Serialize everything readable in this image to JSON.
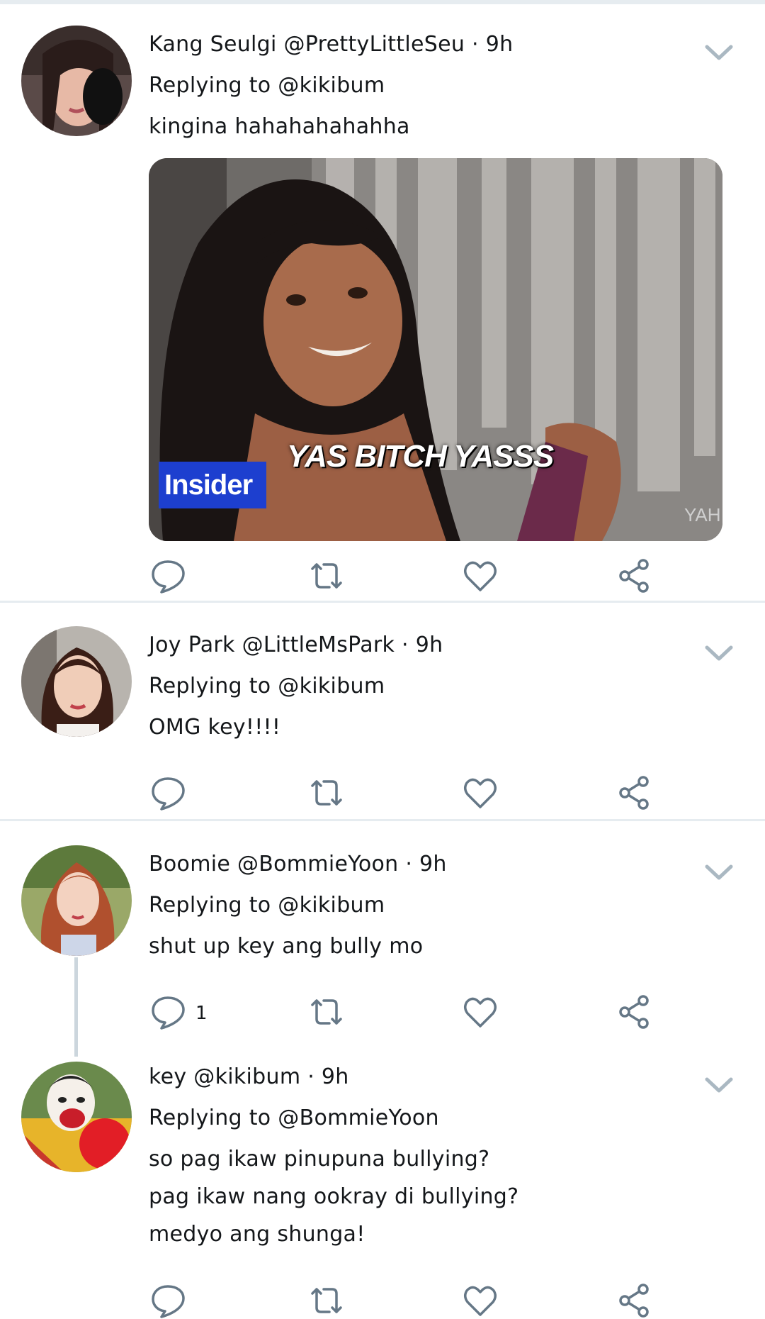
{
  "tweets": [
    {
      "name": "Kang Seulgi",
      "handle": "@PrettyLittleSeu",
      "time": "9h",
      "reply_label": "Replying to",
      "reply_to": "@kikibum",
      "text_lines": [
        "kingina hahahahahahha"
      ],
      "has_media": true,
      "reply_count": ""
    },
    {
      "name": "Joy Park",
      "handle": "@LittleMsPark",
      "time": "9h",
      "reply_label": "Replying to",
      "reply_to": "@kikibum",
      "text_lines": [
        "OMG key!!!!"
      ],
      "has_media": false,
      "reply_count": ""
    },
    {
      "name": "Boomie",
      "handle": "@BommieYoon",
      "time": "9h",
      "reply_label": "Replying to",
      "reply_to": "@kikibum",
      "text_lines": [
        "shut up key ang bully mo"
      ],
      "has_media": false,
      "reply_count": "1"
    },
    {
      "name": "key",
      "handle": "@kikibum",
      "time": "9h",
      "reply_label": "Replying to",
      "reply_to": "@BommieYoon",
      "text_lines": [
        "so pag ikaw pinupuna bullying?",
        "pag ikaw nang ookray di bullying?",
        "medyo ang shunga!"
      ],
      "has_media": false,
      "reply_count": ""
    }
  ],
  "media": {
    "caption": "YAS BITCH YASSS",
    "badge": "Insider",
    "watermark": "YAH"
  },
  "separator": "·",
  "icons": [
    "reply-icon",
    "retweet-icon",
    "like-icon",
    "share-icon",
    "chevron-down-icon"
  ],
  "colors": {
    "divider": "#e6ecf0",
    "icon": "#657786",
    "text": "#14171a"
  }
}
